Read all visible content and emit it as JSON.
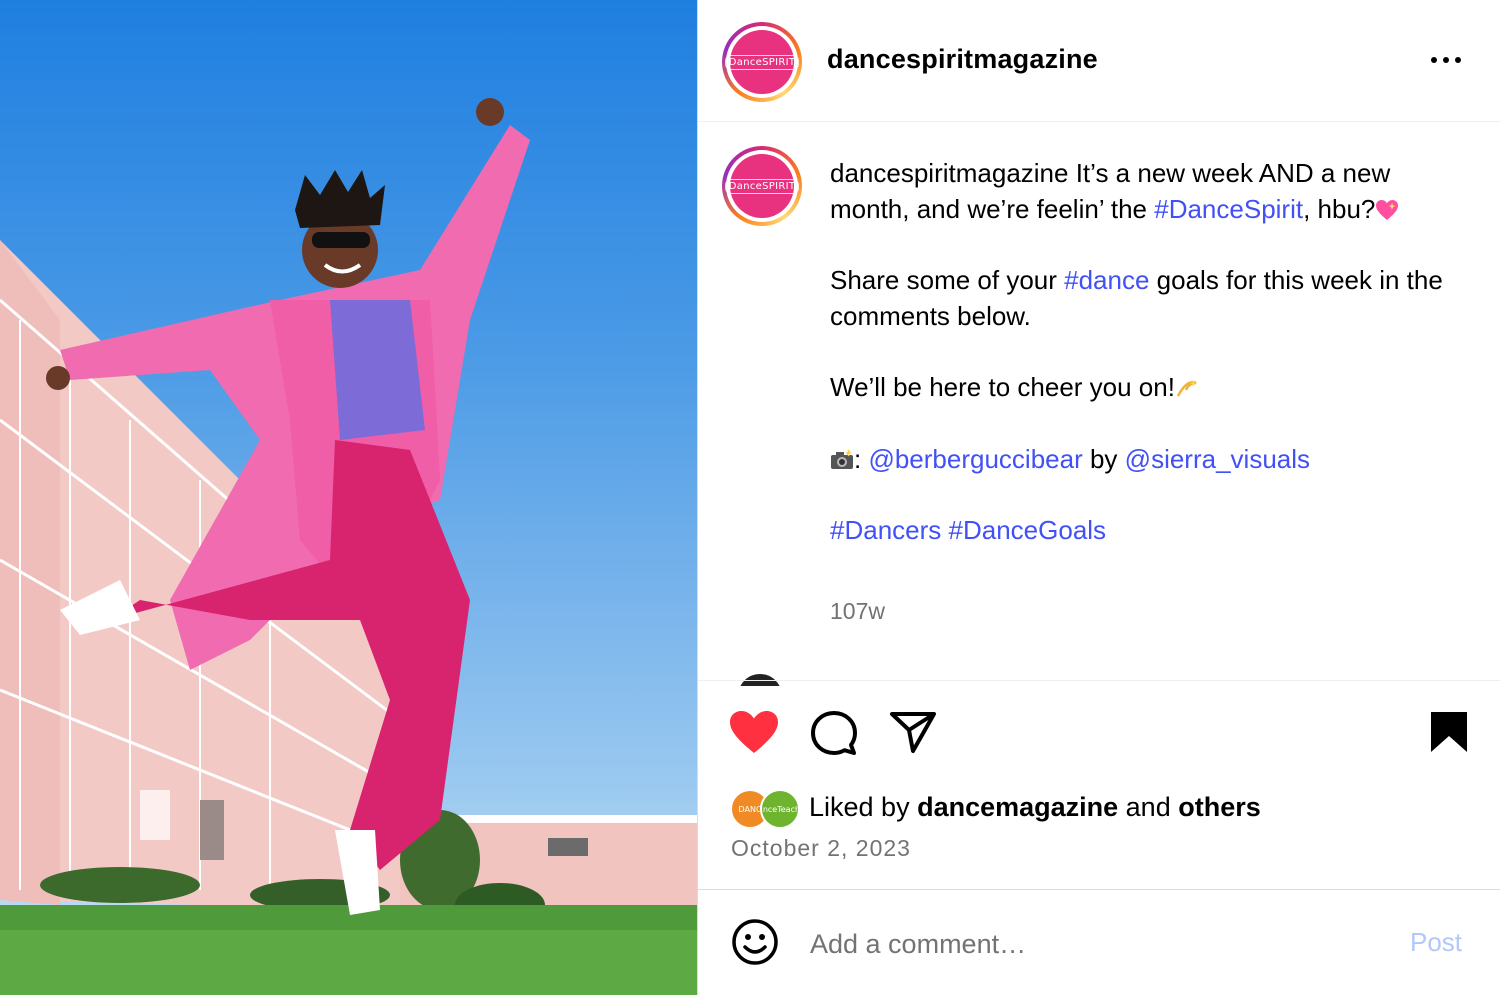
{
  "post": {
    "author": "dancespiritmagazine",
    "avatar_logo_text": "DanceSPIRIT",
    "caption": {
      "author": "dancespiritmagazine",
      "line1_text": " It’s a new week AND a new month, and we’re feelin’ the ",
      "line1_tag": "#DanceSpirit",
      "line1_end": ", hbu?",
      "line1_emoji": "sparkling-heart-emoji",
      "line2_start": "Share some of your ",
      "line2_tag": "#dance",
      "line2_end": " goals for this week in the comments below.",
      "line3_text": "We’ll be here to cheer you on!",
      "line3_emoji": "dizzy-emoji",
      "credit_emoji": "camera-flash-emoji",
      "credit_sep": ": ",
      "credit_photo_handle": "@berberguccibear",
      "credit_by": " by ",
      "credit_visuals_handle": "@sierra_visuals",
      "tag_dancers": "#Dancers",
      "tag_dancegoals": "#DanceGoals"
    },
    "age": "107w",
    "liked_by_prefix": "Liked by ",
    "liked_by_user": "dancemagazine",
    "liked_by_mid": " and ",
    "liked_by_others": "others",
    "liked_avatar_1_text": "DANC",
    "liked_avatar_2_text": "DanceTeacher",
    "date": "October 2, 2023",
    "liked": true,
    "saved": true
  },
  "comment_box": {
    "placeholder": "Add a comment…",
    "post_label": "Post"
  },
  "colors": {
    "accent_link": "#4150f7",
    "like_red": "#ff3040",
    "avatar_pink": "#e8317f",
    "muted_text": "#737373",
    "post_disabled": "#b2c8fb"
  }
}
